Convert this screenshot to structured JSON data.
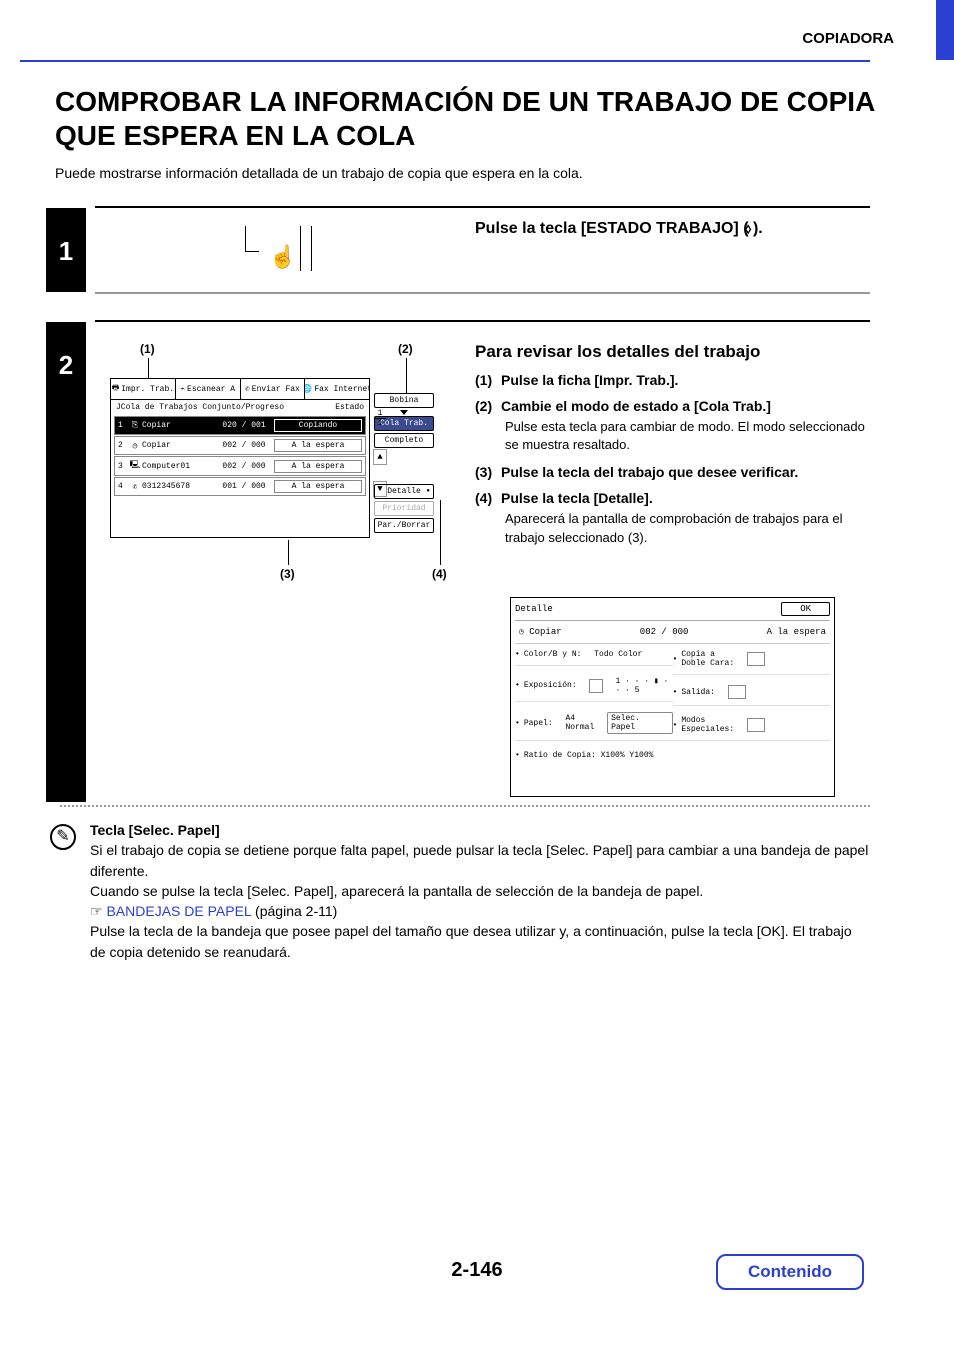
{
  "header": {
    "label": "COPIADORA"
  },
  "title": "COMPROBAR LA INFORMACIÓN DE UN TRABAJO DE COPIA QUE ESPERA EN LA COLA",
  "intro": "Puede mostrarse información detallada de un trabajo de copia que espera en la cola.",
  "steps": {
    "s1": {
      "num": "1",
      "heading": "Pulse la tecla [ESTADO TRABAJO] (       )."
    },
    "s2": {
      "num": "2",
      "heading": "Para revisar los detalles del trabajo"
    }
  },
  "callouts": {
    "c1": "(1)",
    "c2": "(2)",
    "c3": "(3)",
    "c4": "(4)"
  },
  "s2_items": [
    {
      "num": "(1)",
      "lbl": "Pulse la ficha [Impr. Trab.]."
    },
    {
      "num": "(2)",
      "lbl": "Cambie el modo de estado a [Cola Trab.]",
      "desc": "Pulse esta tecla para cambiar de modo. El modo seleccionado se muestra resaltado."
    },
    {
      "num": "(3)",
      "lbl": "Pulse la tecla del trabajo que desee verificar."
    },
    {
      "num": "(4)",
      "lbl": "Pulse la tecla [Detalle].",
      "desc": "Aparecerá la pantalla de comprobación de trabajos para el trabajo seleccionado (3)."
    }
  ],
  "panel1": {
    "tabs": [
      "Impr. Trab.",
      "Escanear A",
      "Enviar Fax",
      "Fax Internet"
    ],
    "bar_left": "JCola de Trabajos Conjunto/Progreso",
    "bar_right": "Estado",
    "jobs": [
      {
        "idx": "1",
        "name": "Copiar",
        "count": "020 / 001",
        "status": "Copiando",
        "sel": true,
        "ico": "copy"
      },
      {
        "idx": "2",
        "name": "Copiar",
        "count": "002 / 000",
        "status": "A la espera",
        "sel": false,
        "ico": "clock"
      },
      {
        "idx": "3",
        "name": "Computer01",
        "count": "002 / 000",
        "status": "A la espera",
        "sel": false,
        "ico": "pc"
      },
      {
        "idx": "4",
        "name": "0312345678",
        "count": "001 / 000",
        "status": "A la espera",
        "sel": false,
        "ico": "phone"
      }
    ],
    "side": {
      "bobina": "Bobina",
      "cola": "Cola Trab.",
      "completo": "Completo"
    },
    "pages": {
      "top": "1",
      "bot": "1"
    },
    "actions": {
      "detalle": "Detalle",
      "prioridad": "Prioridad",
      "parborrar": "Par./Borrar"
    }
  },
  "panel2": {
    "title": "Detalle",
    "ok": "OK",
    "sub_name": "Copiar",
    "sub_count": "002 / 000",
    "sub_status": "A la espera",
    "left": {
      "color_lbl": "Color/B y N:",
      "color_val": "Todo Color",
      "exp_lbl": "Exposición:",
      "exp_val": "1 · · · ▮ · · · 5",
      "papel_lbl": "Papel:",
      "papel_val": "A4\nNormal",
      "selec": "Selec. Papel",
      "ratio": "Ratio de Copia: X100% Y100%"
    },
    "right": {
      "doble_lbl": "Copia a\nDoble Cara:",
      "salida_lbl": "Salida:",
      "modos_lbl": "Modos\nEspeciales:"
    }
  },
  "note": {
    "h": "Tecla [Selec. Papel]",
    "p1": "Si el trabajo de copia se detiene porque falta papel, puede pulsar la tecla [Selec. Papel] para cambiar a una bandeja de papel diferente.",
    "p2": "Cuando se pulse la tecla [Selec. Papel], aparecerá la pantalla de selección de la bandeja de papel.",
    "link_pre": "☞ ",
    "link": "BANDEJAS DE PAPEL",
    "link_post": " (página 2-11)",
    "p3": "Pulse la tecla de la bandeja que posee papel del tamaño que desea utilizar y, a continuación, pulse la tecla [OK]. El trabajo de copia detenido se reanudará."
  },
  "footer": {
    "page": "2-146",
    "contenido": "Contenido"
  }
}
